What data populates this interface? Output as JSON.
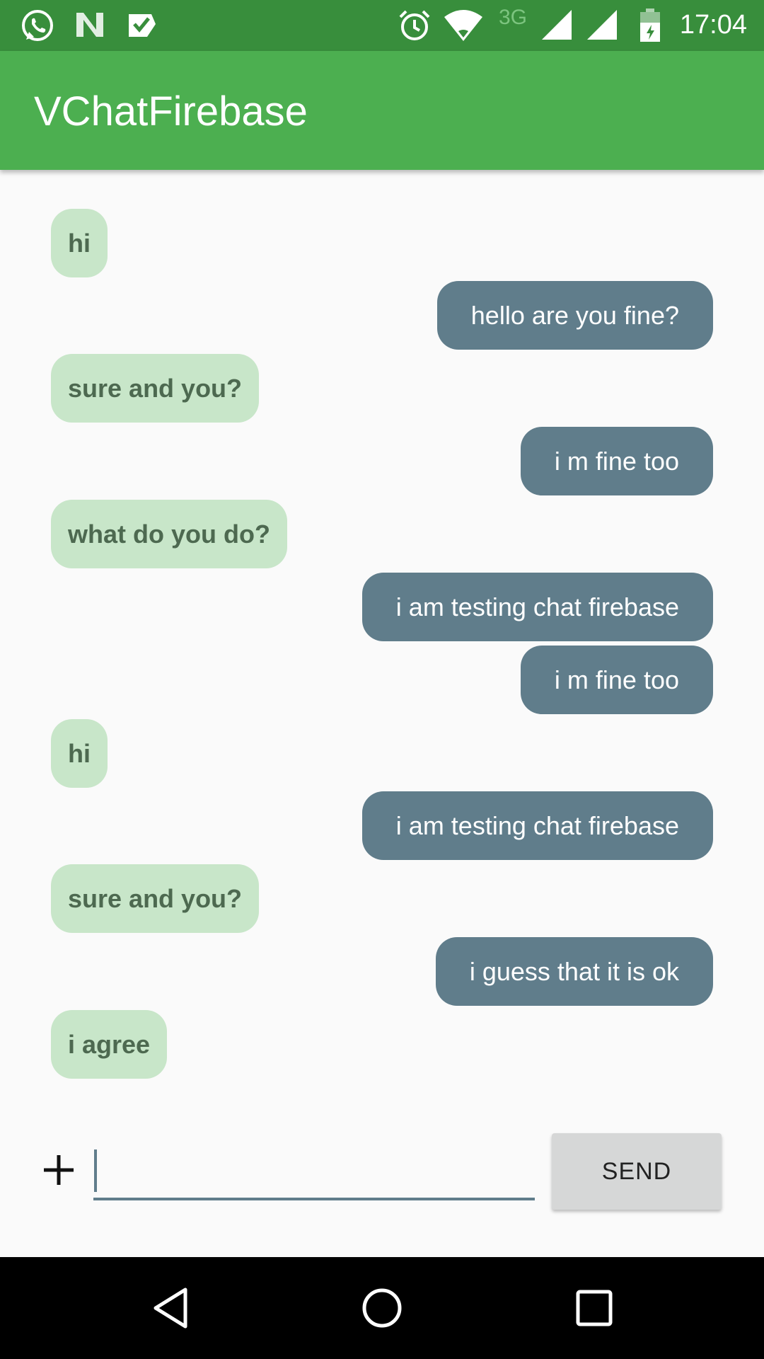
{
  "status_bar": {
    "network_label": "3G",
    "time": "17:04",
    "icons": [
      "whatsapp-icon",
      "n-app-icon",
      "task-check-icon",
      "alarm-icon",
      "wifi-icon",
      "signal-icon",
      "signal-icon",
      "battery-icon"
    ]
  },
  "app_bar": {
    "title": "VChatFirebase",
    "color": "#4caf50",
    "status_color": "#388e3c"
  },
  "messages": [
    {
      "text": "hi",
      "side": "in"
    },
    {
      "text": "hello are you fine?",
      "side": "out"
    },
    {
      "text": "sure and you?",
      "side": "in"
    },
    {
      "text": "i m fine too",
      "side": "out"
    },
    {
      "text": "what do you do?",
      "side": "in"
    },
    {
      "text": "i am testing chat firebase",
      "side": "out"
    },
    {
      "text": "i m fine too",
      "side": "out"
    },
    {
      "text": "hi",
      "side": "in"
    },
    {
      "text": "i am testing chat firebase",
      "side": "out"
    },
    {
      "text": "sure and you?",
      "side": "in"
    },
    {
      "text": "i guess that it is ok",
      "side": "out"
    },
    {
      "text": "i agree",
      "side": "in"
    }
  ],
  "bubble_colors": {
    "incoming": "#c8e6c9",
    "outgoing": "#607d8b"
  },
  "composer": {
    "input_value": "",
    "send_label": "SEND",
    "attach_icon": "plus-icon"
  },
  "nav_bar": {
    "icons": [
      "back-icon",
      "home-icon",
      "recents-icon"
    ]
  }
}
